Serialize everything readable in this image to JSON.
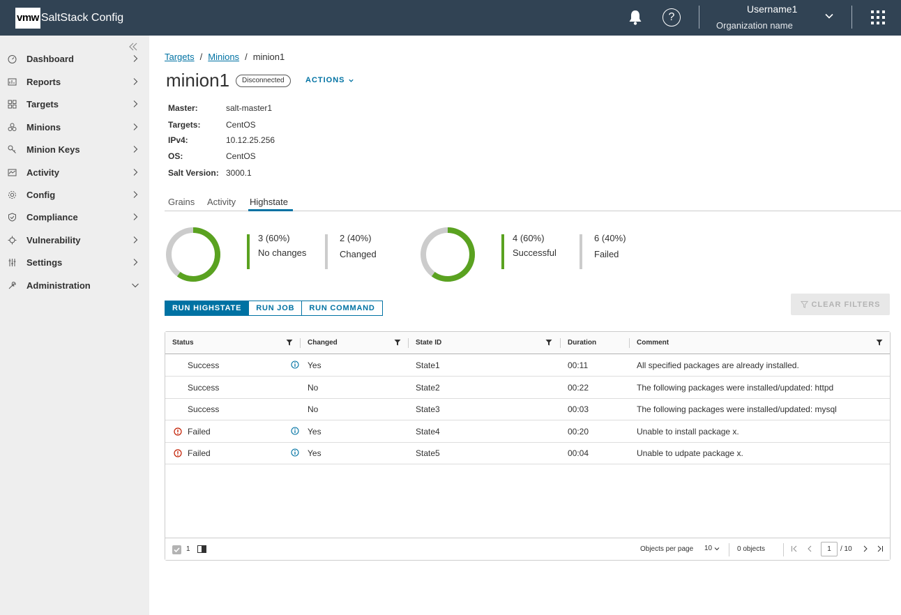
{
  "header": {
    "logo": "vmw",
    "app_title": "SaltStack Config",
    "user_name": "Username1",
    "org_name": "Organization name"
  },
  "sidebar": {
    "items": [
      {
        "label": "Dashboard",
        "icon": "dashboard-icon",
        "expanded": false
      },
      {
        "label": "Reports",
        "icon": "reports-icon",
        "expanded": false
      },
      {
        "label": "Targets",
        "icon": "targets-icon",
        "expanded": false
      },
      {
        "label": "Minions",
        "icon": "minions-icon",
        "expanded": false
      },
      {
        "label": "Minion Keys",
        "icon": "key-icon",
        "expanded": false
      },
      {
        "label": "Activity",
        "icon": "activity-icon",
        "expanded": false
      },
      {
        "label": "Config",
        "icon": "config-icon",
        "expanded": false
      },
      {
        "label": "Compliance",
        "icon": "compliance-icon",
        "expanded": false
      },
      {
        "label": "Vulnerability",
        "icon": "vulnerability-icon",
        "expanded": false
      },
      {
        "label": "Settings",
        "icon": "settings-icon",
        "expanded": false
      },
      {
        "label": "Administration",
        "icon": "administration-icon",
        "expanded": true
      }
    ]
  },
  "breadcrumb": {
    "items": [
      "Targets",
      "Minions"
    ],
    "current": "minion1",
    "separator": "/"
  },
  "page": {
    "title": "minion1",
    "status": "Disconnected",
    "actions_label": "ACTIONS"
  },
  "properties": [
    {
      "key": "Master:",
      "value": "salt-master1"
    },
    {
      "key": "Targets:",
      "value": "CentOS"
    },
    {
      "key": "IPv4:",
      "value": "10.12.25.256"
    },
    {
      "key": "OS:",
      "value": "CentOS"
    },
    {
      "key": "Salt Version:",
      "value": "3000.1"
    }
  ],
  "tabs": [
    {
      "label": "Grains",
      "active": false
    },
    {
      "label": "Activity",
      "active": false
    },
    {
      "label": "Highstate",
      "active": true
    }
  ],
  "summary": {
    "changes": {
      "fraction_primary": 0.6,
      "primary": {
        "value": "3 (60%)",
        "label": "No changes"
      },
      "secondary": {
        "value": "2 (40%)",
        "label": "Changed"
      }
    },
    "results": {
      "fraction_primary": 0.6,
      "primary": {
        "value": "4 (60%)",
        "label": "Successful"
      },
      "secondary": {
        "value": "6 (40%)",
        "label": "Failed"
      }
    }
  },
  "toolbar": {
    "run_highstate": "RUN HIGHSTATE",
    "run_job": "RUN JOB",
    "run_command": "RUN COMMAND",
    "clear_filters": "CLEAR FILTERS"
  },
  "table": {
    "columns": [
      "Status",
      "Changed",
      "State ID",
      "Duration",
      "Comment"
    ],
    "rows": [
      {
        "status": "Success",
        "failed": false,
        "info": true,
        "changed": "Yes",
        "state_id": "State1",
        "duration": "00:11",
        "comment": "All specified packages are already installed."
      },
      {
        "status": "Success",
        "failed": false,
        "info": false,
        "changed": "No",
        "state_id": "State2",
        "duration": "00:22",
        "comment": "The following packages were installed/updated: httpd"
      },
      {
        "status": "Success",
        "failed": false,
        "info": false,
        "changed": "No",
        "state_id": "State3",
        "duration": "00:03",
        "comment": "The following packages were installed/updated: mysql"
      },
      {
        "status": "Failed",
        "failed": true,
        "info": true,
        "changed": "Yes",
        "state_id": "State4",
        "duration": "00:20",
        "comment": "Unable to install package x."
      },
      {
        "status": "Failed",
        "failed": true,
        "info": true,
        "changed": "Yes",
        "state_id": "State5",
        "duration": "00:04",
        "comment": "Unable to udpate package x."
      }
    ],
    "footer": {
      "selected_count": "1",
      "objects_per_page_label": "Objects per page",
      "per_page": "10",
      "objects_count": "0 objects",
      "current_page": "1",
      "total_pages": "/ 10"
    }
  },
  "colors": {
    "header_bg": "#314354",
    "accent": "#0072a3",
    "success_green": "#5aa220",
    "neutral_gray": "#cccccc",
    "error_red": "#c21d00"
  }
}
